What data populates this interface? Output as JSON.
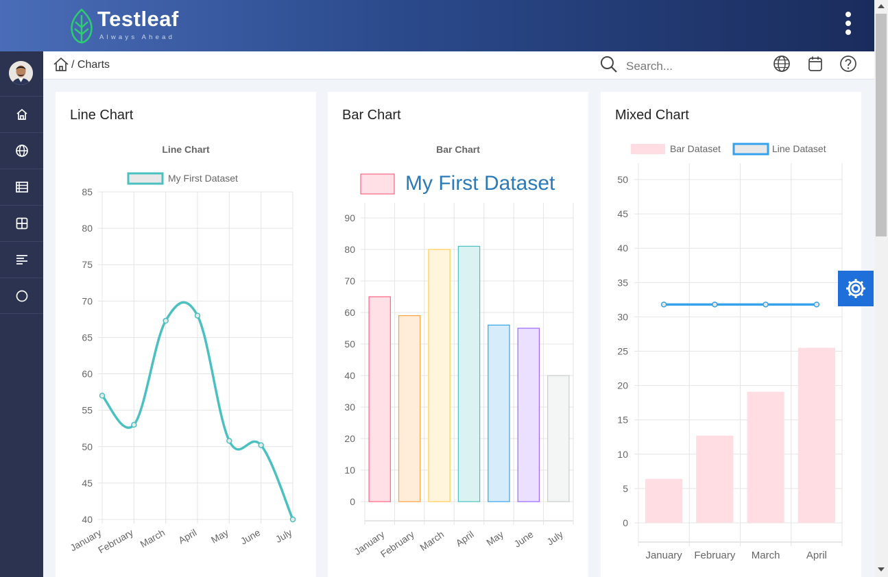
{
  "header": {
    "brand_name": "Testleaf",
    "brand_tagline": "Always Ahead",
    "menu_icon": "kebab-menu-icon"
  },
  "sidebar": {
    "items": [
      {
        "icon": "home-icon"
      },
      {
        "icon": "globe-icon"
      },
      {
        "icon": "table-icon"
      },
      {
        "icon": "grid-icon"
      },
      {
        "icon": "list-icon"
      },
      {
        "icon": "circle-icon"
      }
    ]
  },
  "breadcrumb": {
    "separator": "/",
    "current": "Charts"
  },
  "search": {
    "placeholder": "Search..."
  },
  "top_icons": [
    "globe-icon",
    "calendar-icon",
    "help-icon"
  ],
  "colors": {
    "line": "#4bc0c0",
    "mixed_line": "#36a2eb",
    "mixed_bar": "#ffdde3",
    "settings_button": "#1e6fd9"
  },
  "cards": {
    "line": {
      "title": "Line Chart"
    },
    "bar": {
      "title": "Bar Chart"
    },
    "mixed": {
      "title": "Mixed Chart"
    }
  },
  "chart_data": [
    {
      "type": "line",
      "title": "Line Chart",
      "legend": [
        "My First Dataset"
      ],
      "legend_position": "top",
      "categories": [
        "January",
        "February",
        "March",
        "April",
        "May",
        "June",
        "July"
      ],
      "series": [
        {
          "name": "My First Dataset",
          "values": [
            57,
            53,
            67.3,
            68,
            50.8,
            50.2,
            40
          ]
        }
      ],
      "ylim": [
        40,
        85
      ],
      "yticks": [
        85,
        80,
        75,
        70,
        65,
        60,
        55,
        50,
        45,
        40
      ],
      "grid": true
    },
    {
      "type": "bar",
      "title": "Bar Chart",
      "legend": [
        "My First Dataset"
      ],
      "legend_position": "top",
      "categories": [
        "January",
        "February",
        "March",
        "April",
        "May",
        "June",
        "July"
      ],
      "series": [
        {
          "name": "My First Dataset",
          "values": [
            65,
            59,
            80,
            81,
            56,
            55,
            40
          ]
        }
      ],
      "bar_fill": [
        "#ffe0e6",
        "#ffecd9",
        "#fff5dd",
        "#dbf2f2",
        "#d7ecfb",
        "#ebe0ff",
        "#f4f5f5"
      ],
      "bar_stroke": [
        "#ff6384",
        "#ff9f40",
        "#ffcd56",
        "#4bc0c0",
        "#36a2eb",
        "#9966ff",
        "#c9cbcf"
      ],
      "ylim": [
        0,
        90
      ],
      "yticks": [
        90,
        80,
        70,
        60,
        50,
        40,
        30,
        20,
        10,
        0
      ],
      "grid": true
    },
    {
      "type": "bar",
      "title": "",
      "legend": [
        "Bar Dataset",
        "Line Dataset"
      ],
      "legend_position": "top",
      "categories": [
        "January",
        "February",
        "March",
        "April"
      ],
      "series": [
        {
          "name": "Bar Dataset",
          "type": "bar",
          "values": [
            6.4,
            12.7,
            19.1,
            25.5
          ]
        },
        {
          "name": "Line Dataset",
          "type": "line",
          "values": [
            31.8,
            31.8,
            31.8,
            31.8
          ]
        }
      ],
      "ylim": [
        0,
        50
      ],
      "yticks": [
        50,
        45,
        40,
        35,
        30,
        25,
        20,
        15,
        10,
        5,
        0
      ],
      "grid": true
    }
  ]
}
